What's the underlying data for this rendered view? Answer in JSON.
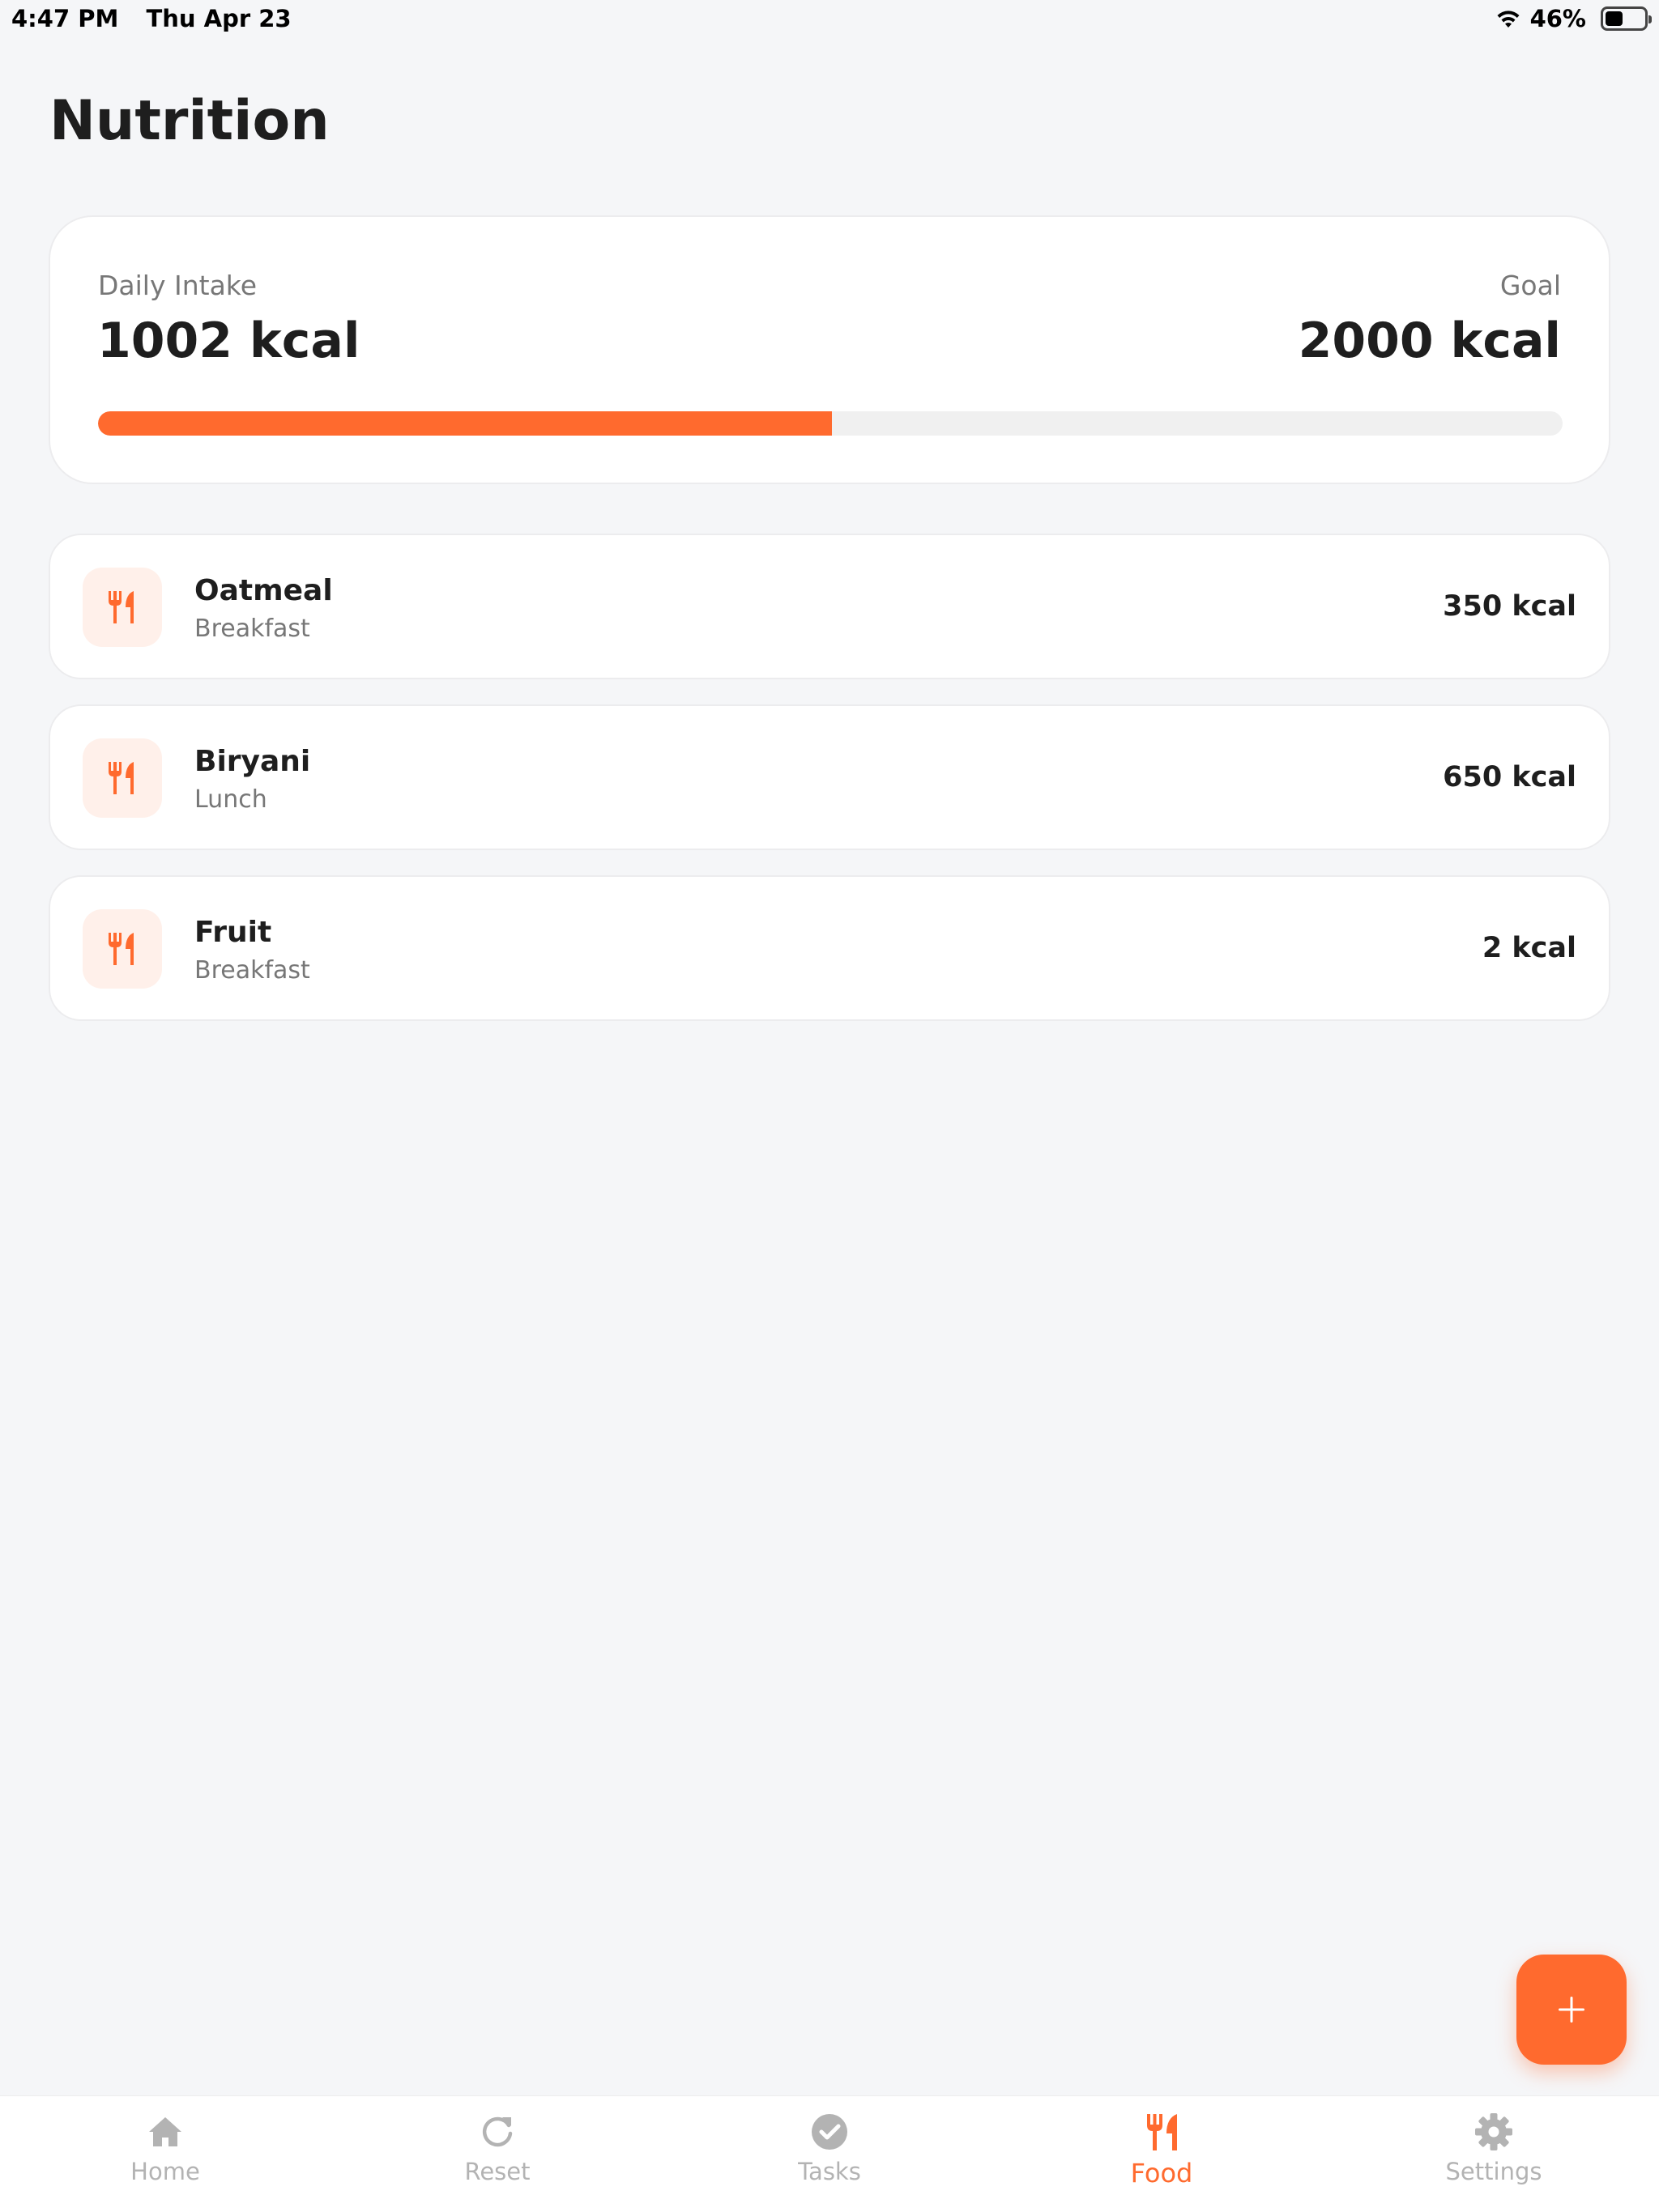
{
  "status_bar": {
    "time": "4:47 PM",
    "date": "Thu Apr 23",
    "battery_percent": "46%",
    "battery_level": 0.46,
    "icons": [
      "wifi-icon",
      "battery-icon"
    ]
  },
  "header": {
    "title": "Nutrition"
  },
  "intake": {
    "daily_label": "Daily Intake",
    "daily_value": "1002 kcal",
    "goal_label": "Goal",
    "goal_value": "2000 kcal",
    "progress_fraction": 0.501
  },
  "food_items": [
    {
      "name": "Oatmeal",
      "meal": "Breakfast",
      "kcal": "350 kcal",
      "icon": "utensils-icon"
    },
    {
      "name": "Biryani",
      "meal": "Lunch",
      "kcal": "650 kcal",
      "icon": "utensils-icon"
    },
    {
      "name": "Fruit",
      "meal": "Breakfast",
      "kcal": "2 kcal",
      "icon": "utensils-icon"
    }
  ],
  "fab": {
    "icon": "plus-icon"
  },
  "tabs": [
    {
      "label": "Home",
      "icon": "home-icon",
      "active": false
    },
    {
      "label": "Reset",
      "icon": "refresh-icon",
      "active": false
    },
    {
      "label": "Tasks",
      "icon": "check-circle-icon",
      "active": false
    },
    {
      "label": "Food",
      "icon": "utensils-icon",
      "active": true
    },
    {
      "label": "Settings",
      "icon": "gear-icon",
      "active": false
    }
  ],
  "colors": {
    "accent": "#ff6a2e",
    "accent_light": "#fff0ea",
    "background": "#f5f6f8",
    "inactive": "#b3b3b3",
    "text": "#1e1e1e",
    "muted": "#777777"
  }
}
